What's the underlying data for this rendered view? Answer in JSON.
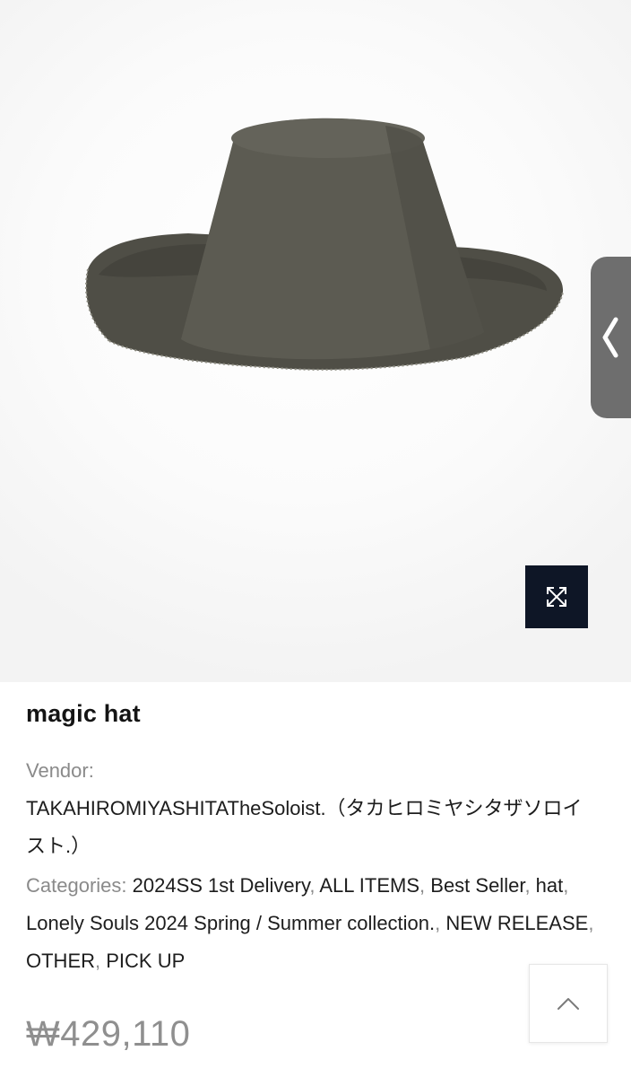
{
  "product": {
    "title": "magic hat",
    "vendor_label": "Vendor:",
    "vendor_name": "TAKAHIROMIYASHITATheSoloist.（タカヒロミヤシタザソロイスト.）",
    "categories_label": "Categories:",
    "categories": [
      "2024SS 1st Delivery",
      "ALL ITEMS",
      "Best Seller",
      "hat",
      "Lonely Souls 2024 Spring / Summer collection.",
      "NEW RELEASE",
      "OTHER",
      "PICK UP"
    ],
    "category_separator": ", ",
    "price": "₩429,110"
  },
  "icons": {
    "zoom": "expand-arrows-icon",
    "side_tab": "chevron-left-icon",
    "back_to_top": "chevron-up-icon"
  },
  "colors": {
    "zoom_button_bg": "#0e1626",
    "side_tab_bg": "#6e6e6e",
    "price_text": "#8f8f8f",
    "label_text": "#8a8a8a",
    "hat": "#56554c"
  }
}
